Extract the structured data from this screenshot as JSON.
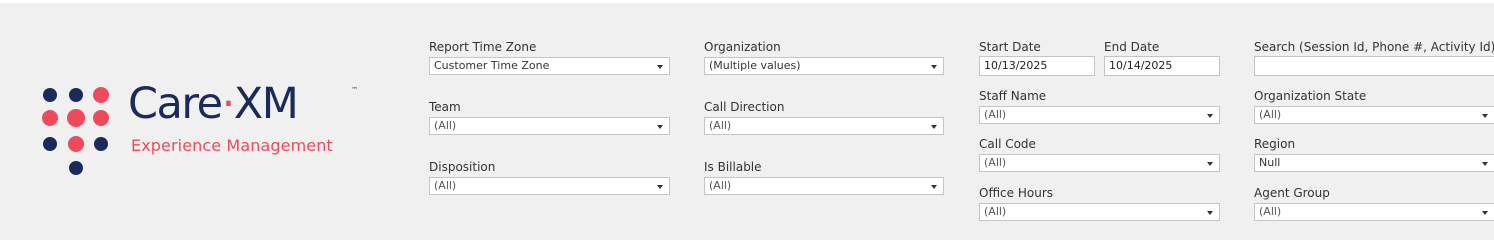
{
  "logo": {
    "brand_left": "Care",
    "brand_dot": "·",
    "brand_right": "XM",
    "trademark": "™",
    "tagline": "Experience Management"
  },
  "filters": {
    "report_time_zone": {
      "label": "Report Time Zone",
      "value": "Customer Time Zone"
    },
    "team": {
      "label": "Team",
      "value": "(All)"
    },
    "disposition": {
      "label": "Disposition",
      "value": "(All)"
    },
    "organization": {
      "label": "Organization",
      "value": "(Multiple values)"
    },
    "call_direction": {
      "label": "Call Direction",
      "value": "(All)"
    },
    "is_billable": {
      "label": "Is Billable",
      "value": "(All)"
    },
    "start_date": {
      "label": "Start Date",
      "value": "10/13/2025"
    },
    "end_date": {
      "label": "End Date",
      "value": "10/14/2025"
    },
    "staff_name": {
      "label": "Staff Name",
      "value": "(All)"
    },
    "call_code": {
      "label": "Call Code",
      "value": "(All)"
    },
    "office_hours": {
      "label": "Office Hours",
      "value": "(All)"
    },
    "search": {
      "label": "Search (Session Id, Phone #, Activity Id)",
      "value": ""
    },
    "organization_state": {
      "label": "Organization State",
      "value": "(All)"
    },
    "region": {
      "label": "Region",
      "value": "Null"
    },
    "agent_group": {
      "label": "Agent Group",
      "value": "(All)"
    }
  },
  "colors": {
    "brand_navy": "#1a2a5a",
    "brand_coral": "#ee4a5c",
    "background": "#f0f0f0"
  },
  "icons": {
    "dropdown": "caret-down-icon"
  }
}
